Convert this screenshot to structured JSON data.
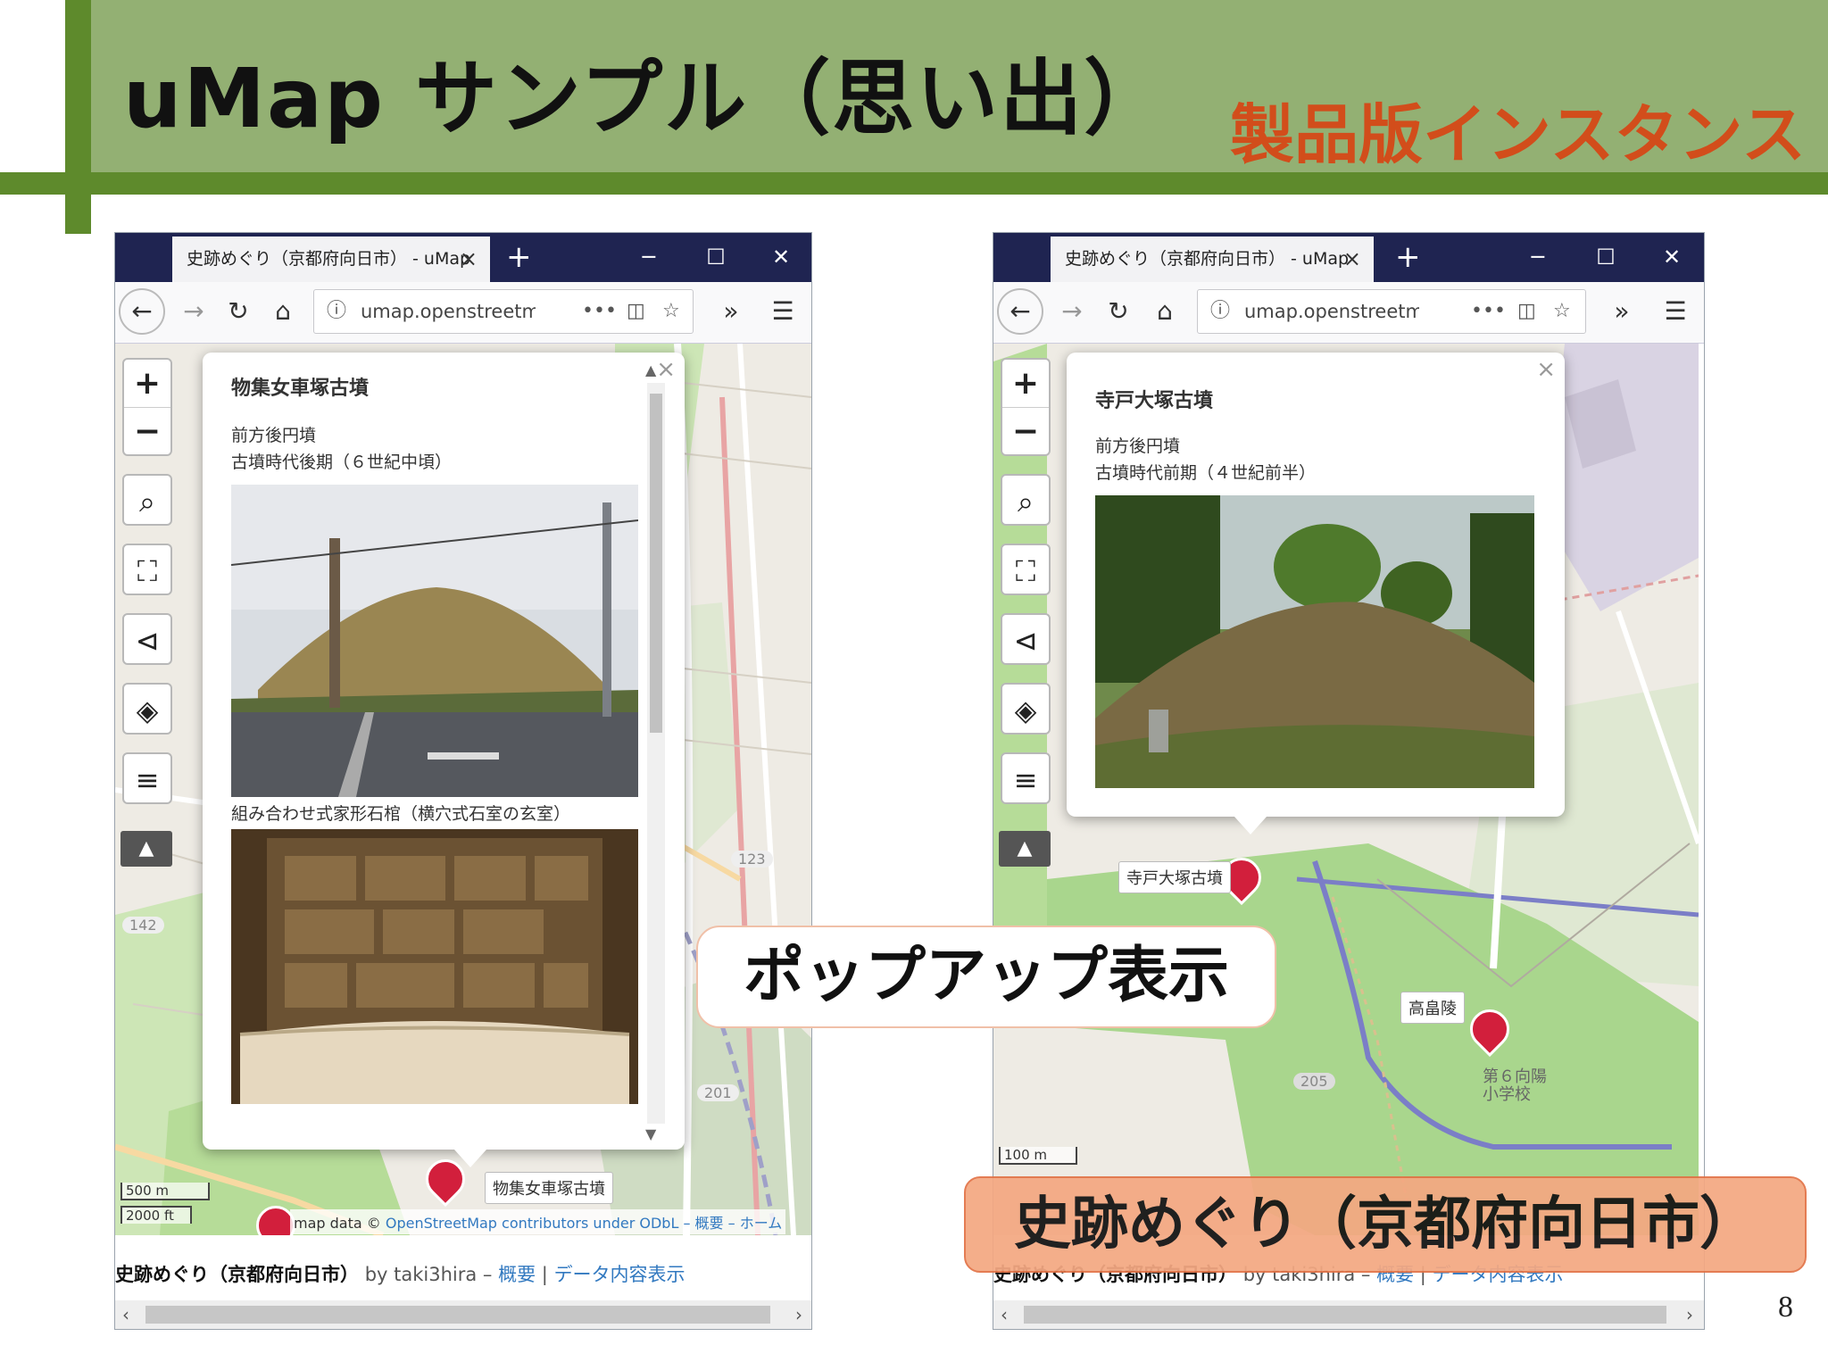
{
  "slide": {
    "title": "uMap サンプル（思い出）",
    "subtitle": "製品版インスタンス",
    "callout_popup": "ポップアップ表示",
    "callout_title": "史跡めぐり（京都府向日市）",
    "page_number": "8",
    "colors": {
      "header": "#93b073",
      "accent": "#5e8a2c",
      "subtitle": "#d24d1b",
      "callout": "#f4a882"
    }
  },
  "browser": {
    "tab_title": "史跡めぐり（京都府向日市） - uMap",
    "tab_close": "×",
    "new_tab": "+",
    "url": "umap.openstreetma",
    "icons": [
      "back-arrow-icon",
      "forward-arrow-icon",
      "reload-icon",
      "home-icon",
      "info-icon",
      "more-icon",
      "pocket-icon",
      "star-icon",
      "overflow-icon",
      "menu-icon"
    ]
  },
  "footer": {
    "map_title": "史跡めぐり（京都府向日市）",
    "by": "by taki3hira",
    "separator1": " – ",
    "link_about": "概要",
    "separator2": " | ",
    "link_data": "データ内容表示"
  },
  "left_map": {
    "popup": {
      "title": "物集女車塚古墳",
      "desc_line1": "前方後円墳",
      "desc_line2": "古墳時代後期（６世紀中頃）",
      "caption2": "組み合わせ式家形石棺（横穴式石室の玄室）"
    },
    "marker_label": "物集女車塚古墳",
    "scale_m": "500 m",
    "scale_ft": "2000 ft",
    "attribution_prefix": "map data © ",
    "attribution_osm": "OpenStreetMap contributors under ODbL",
    "attribution_links": " – 概要 – ホーム",
    "road_numbers": [
      "142",
      "123",
      "201"
    ]
  },
  "right_map": {
    "popup": {
      "title": "寺戸大塚古墳",
      "desc_line1": "前方後円墳",
      "desc_line2": "古墳時代前期（４世紀前半）"
    },
    "marker_label_1": "寺戸大塚古墳",
    "marker_label_2": "高畠陵",
    "school_label": "第６向陽\n小学校",
    "road_number": "205",
    "scale_m": "100 m"
  }
}
